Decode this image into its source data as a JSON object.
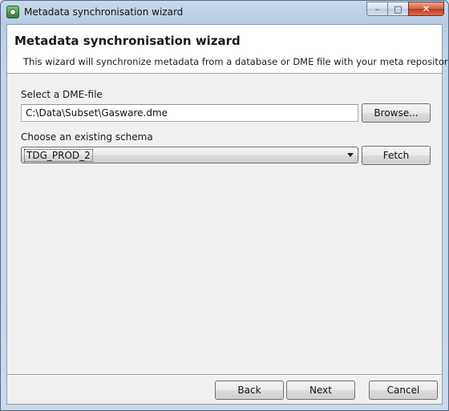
{
  "window": {
    "title": "Metadata synchronisation wizard",
    "icon": "wizard-app-icon",
    "controls": {
      "minimize": "–",
      "maximize": "□",
      "close": "✕"
    }
  },
  "header": {
    "title": "Metadata synchronisation wizard",
    "description": "This wizard will synchronize metadata from a database or DME file with your meta repository."
  },
  "dme": {
    "label": "Select a DME-file",
    "value": "C:\\Data\\Subset\\Gasware.dme",
    "browse_label": "Browse..."
  },
  "schema": {
    "label": "Choose an existing schema",
    "selected": "TDG_PROD_2",
    "fetch_label": "Fetch"
  },
  "footer": {
    "back_label": "Back",
    "next_label": "Next",
    "cancel_label": "Cancel"
  }
}
